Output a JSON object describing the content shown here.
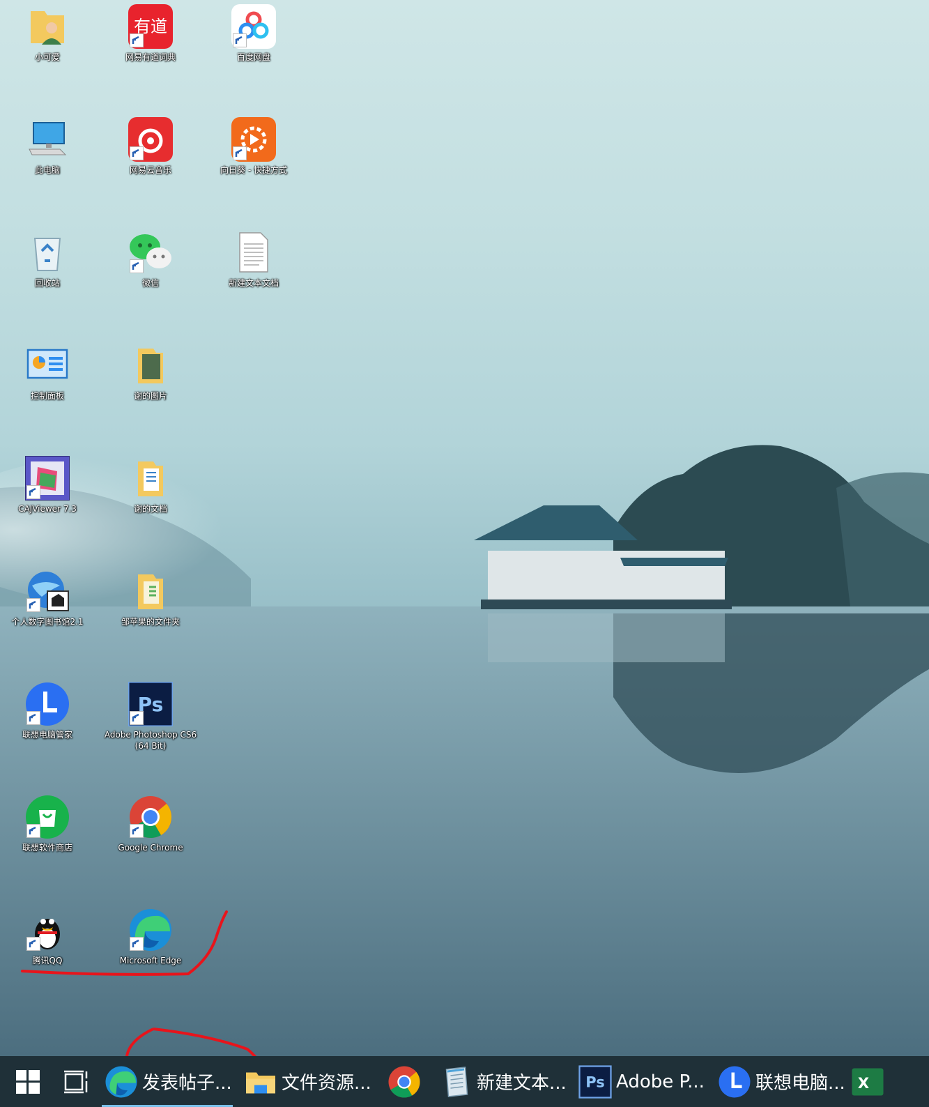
{
  "desktop": {
    "icons": [
      {
        "label": "小可爱",
        "icon": "user-folder-icon",
        "shortcut": false
      },
      {
        "label": "网易有道词典",
        "icon": "youdao-icon",
        "shortcut": true,
        "badge": "有道"
      },
      {
        "label": "百度网盘",
        "icon": "baidu-netdisk-icon",
        "shortcut": true
      },
      {
        "label": "此电脑",
        "icon": "computer-icon",
        "shortcut": false
      },
      {
        "label": "网易云音乐",
        "icon": "netease-music-icon",
        "shortcut": true
      },
      {
        "label": "向日葵 - 快捷方式",
        "icon": "sunflower-icon",
        "shortcut": true
      },
      {
        "label": "回收站",
        "icon": "recycle-bin-icon",
        "shortcut": false
      },
      {
        "label": "微信",
        "icon": "wechat-icon",
        "shortcut": true
      },
      {
        "label": "新建文本文档",
        "icon": "text-document-icon",
        "shortcut": false
      },
      {
        "label": "控制面板",
        "icon": "control-panel-icon",
        "shortcut": false
      },
      {
        "label": "谢的图片",
        "icon": "pictures-folder-icon",
        "shortcut": false
      },
      {
        "label": "CAJViewer 7.3",
        "icon": "cajviewer-icon",
        "shortcut": true
      },
      {
        "label": "谢的文档",
        "icon": "documents-folder-icon",
        "shortcut": false
      },
      {
        "label": "个人数字图书馆2.1",
        "icon": "digital-library-icon",
        "shortcut": true
      },
      {
        "label": "邹苹果的文件夹",
        "icon": "folder-icon",
        "shortcut": false
      },
      {
        "label": "联想电脑管家",
        "icon": "lenovo-manager-icon",
        "shortcut": true
      },
      {
        "label": "Adobe Photoshop CS6 (64 Bit)",
        "icon": "photoshop-icon",
        "shortcut": true,
        "badge": "Ps"
      },
      {
        "label": "联想软件商店",
        "icon": "lenovo-store-icon",
        "shortcut": true
      },
      {
        "label": "Google Chrome",
        "icon": "chrome-icon",
        "shortcut": true
      },
      {
        "label": "腾讯QQ",
        "icon": "qq-icon",
        "shortcut": true
      },
      {
        "label": "Microsoft Edge",
        "icon": "edge-icon",
        "shortcut": true
      }
    ]
  },
  "taskbar": {
    "apps": [
      {
        "label": "发表帖子...",
        "icon": "edge-icon",
        "active": true
      },
      {
        "label": "文件资源...",
        "icon": "file-explorer-icon",
        "active": false
      },
      {
        "label": "",
        "icon": "chrome-icon",
        "active": false
      },
      {
        "label": "新建文本...",
        "icon": "notepad-icon",
        "active": false
      },
      {
        "label": "Adobe P...",
        "icon": "photoshop-icon",
        "active": false
      },
      {
        "label": "联想电脑...",
        "icon": "lenovo-manager-icon",
        "active": false
      },
      {
        "label": "",
        "icon": "excel-icon",
        "active": false
      }
    ],
    "ps_badge": "Ps",
    "excel_badge": "X"
  },
  "colors": {
    "annotation": "#e8141b",
    "taskbar": "#1f3038",
    "accent": "#7ac0ea"
  }
}
